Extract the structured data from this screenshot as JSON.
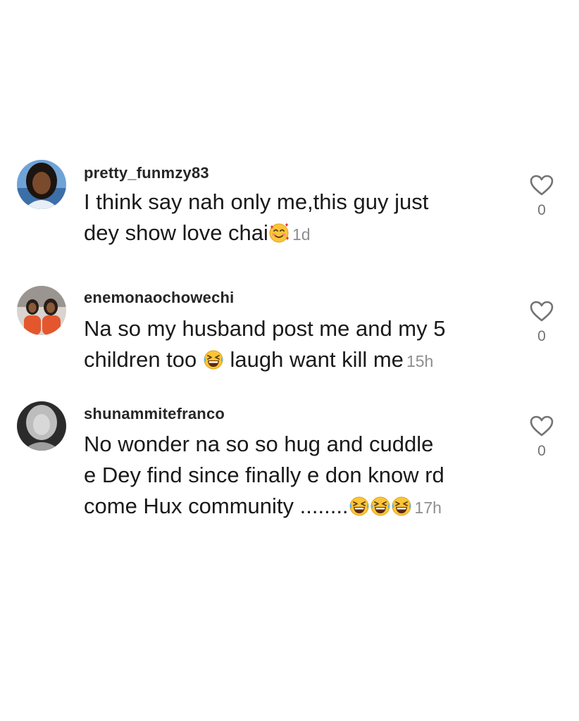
{
  "comments": [
    {
      "username": "pretty_funmzy83",
      "lines": [
        "I think say nah only me,this guy just",
        "dey show love chai"
      ],
      "emojis": [
        "smiling-face-with-hearts"
      ],
      "time": "1d",
      "likes": "0",
      "avatar": "profile-photo"
    },
    {
      "username": "enemonaochowechi",
      "lines": [
        "Na so my husband post me and my 5",
        "children too",
        "laugh want kill me"
      ],
      "emojis": [
        "grinning-squinting-face"
      ],
      "time": "15h",
      "likes": "0",
      "avatar": "profile-photo"
    },
    {
      "username": "shunammitefranco",
      "lines": [
        "No wonder na so so hug and cuddle",
        "e Dey find since finally e don know rd",
        "come Hux community ........"
      ],
      "emojis": [
        "grinning-squinting-face",
        "grinning-squinting-face",
        "grinning-squinting-face"
      ],
      "time": "17h",
      "likes": "0",
      "avatar": "profile-photo"
    }
  ],
  "icons": {
    "like": "heart-outline-icon"
  },
  "colors": {
    "text": "#1a1a1a",
    "username": "#262626",
    "timestamp": "#8e8e8e",
    "icon": "#737373"
  }
}
